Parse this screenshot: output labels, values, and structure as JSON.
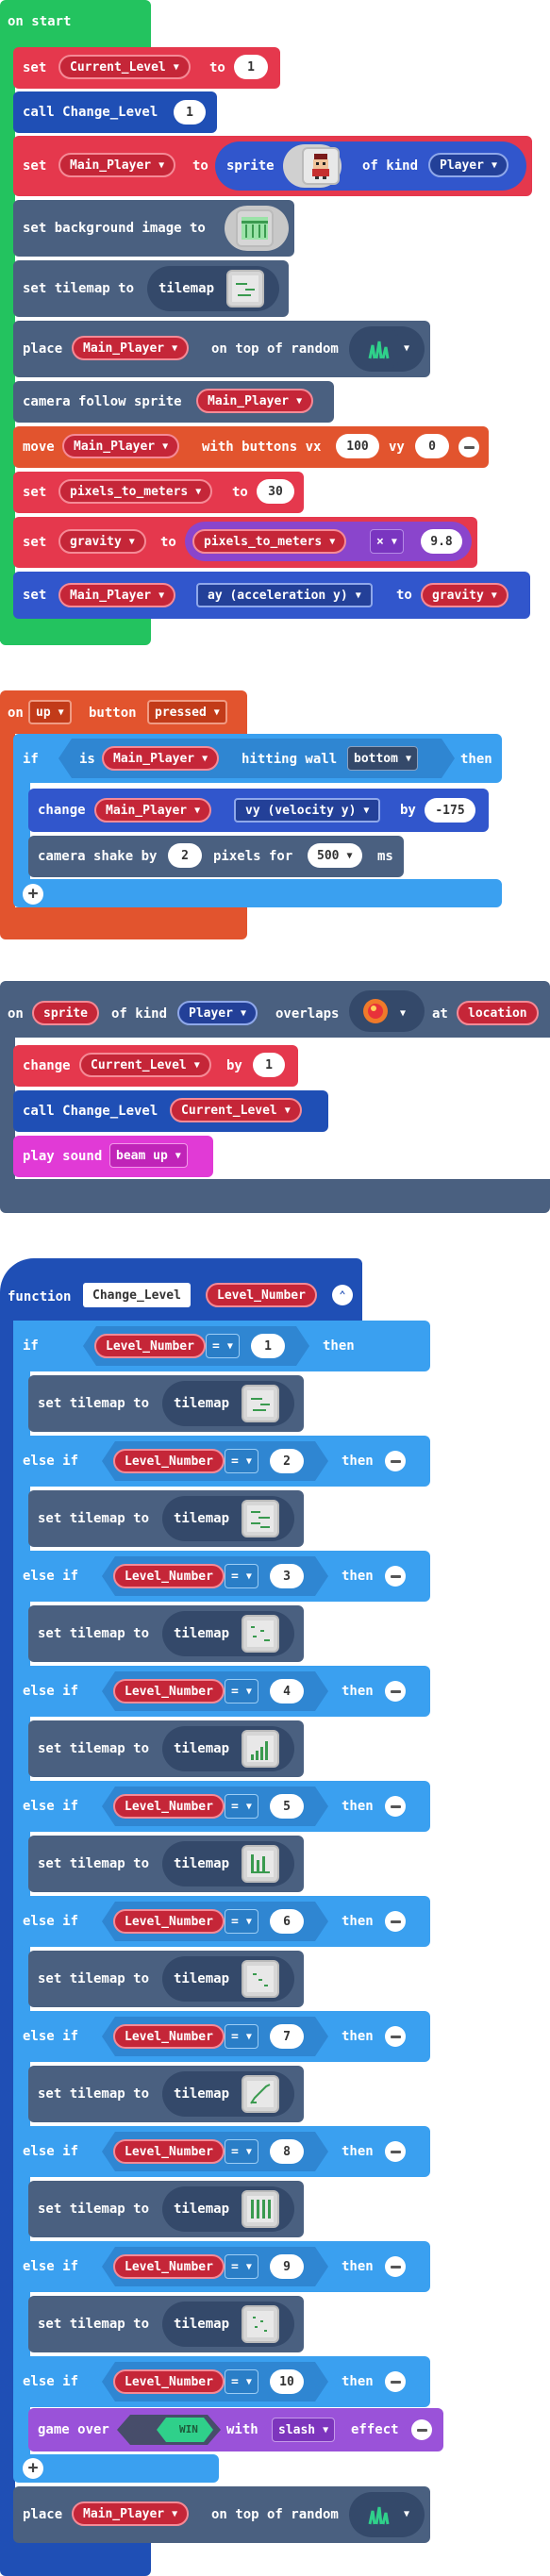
{
  "colors": {
    "event_green": "#23c35f",
    "event_orange": "#e2542e",
    "game_slate": "#4a6080",
    "sprite_blue": "#3156cc",
    "var_red": "#e5384d",
    "logic_blue": "#3aa0f0",
    "music_pink": "#e13ad6",
    "function_blue": "#1f4fb5",
    "scene_dark": "#4a607f",
    "info_purple": "#9a52d9"
  },
  "on_start": {
    "header": "on start",
    "set1": {
      "kw": "set",
      "var": "Current_Level",
      "to": "to",
      "val": "1"
    },
    "call1": {
      "kw": "call Change_Level",
      "val": "1"
    },
    "set_player": {
      "kw": "set",
      "var": "Main_Player",
      "to": "to",
      "sprite": "sprite",
      "of_kind": "of kind",
      "kind": "Player"
    },
    "bg": {
      "text": "set background image to"
    },
    "tilemap": {
      "text": "set tilemap to",
      "pill": "tilemap"
    },
    "place": {
      "kw": "place",
      "var": "Main_Player",
      "rest": "on top of random"
    },
    "camera": {
      "text": "camera follow sprite",
      "var": "Main_Player"
    },
    "move": {
      "kw": "move",
      "var": "Main_Player",
      "with": "with buttons vx",
      "vx": "100",
      "vy_lbl": "vy",
      "vy": "0"
    },
    "set_ptm": {
      "kw": "set",
      "var": "pixels_to_meters",
      "to": "to",
      "val": "30"
    },
    "set_gravity": {
      "kw": "set",
      "var": "gravity",
      "to": "to",
      "inner_var": "pixels_to_meters",
      "op": "×",
      "val": "9.8"
    },
    "set_ay": {
      "kw": "set",
      "var": "Main_Player",
      "prop": "ay (acceleration y)",
      "to": "to",
      "val_var": "gravity"
    }
  },
  "on_button": {
    "on": "on",
    "button": "up",
    "btn_lbl": "button",
    "event": "pressed",
    "if": "if",
    "is": "is",
    "var": "Main_Player",
    "hitting": "hitting wall",
    "wall": "bottom",
    "then": "then",
    "change": {
      "kw": "change",
      "var": "Main_Player",
      "prop": "vy (velocity y)",
      "by": "by",
      "val": "-175"
    },
    "shake": {
      "kw": "camera shake by",
      "val": "2",
      "mid": "pixels for",
      "ms_val": "500",
      "ms": "ms"
    }
  },
  "on_overlap": {
    "on": "on",
    "sprite": "sprite",
    "of_kind": "of kind",
    "kind": "Player",
    "overlaps": "overlaps",
    "at": "at",
    "location": "location",
    "change": {
      "kw": "change",
      "var": "Current_Level",
      "by": "by",
      "val": "1"
    },
    "call": {
      "kw": "call Change_Level",
      "var": "Current_Level"
    },
    "sound": {
      "kw": "play sound",
      "val": "beam up"
    }
  },
  "function": {
    "kw": "function",
    "name": "Change_Level",
    "param": "Level_Number",
    "if_kw": "if",
    "elseif_kw": "else if",
    "then": "then",
    "eq": "=",
    "var": "Level_Number",
    "set_tilemap": "set tilemap to",
    "tilemap": "tilemap",
    "levels": [
      "1",
      "2",
      "3",
      "4",
      "5",
      "6",
      "7",
      "8",
      "9",
      "10"
    ],
    "game_over": {
      "kw": "game over",
      "win": "WIN",
      "with": "with",
      "effect_val": "slash",
      "effect": "effect"
    },
    "place": {
      "kw": "place",
      "var": "Main_Player",
      "rest": "on top of random"
    }
  }
}
